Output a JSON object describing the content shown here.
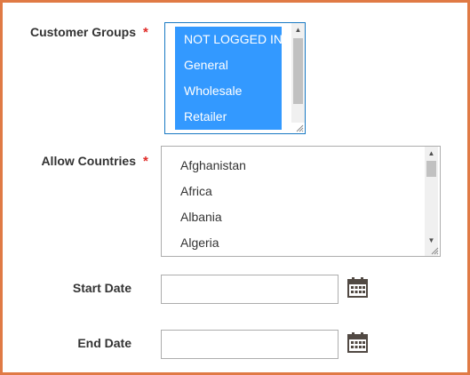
{
  "form": {
    "customer_groups": {
      "label": "Customer Groups",
      "required_mark": "*",
      "options": [
        "NOT LOGGED IN",
        "General",
        "Wholesale",
        "Retailer"
      ],
      "selected": [
        "NOT LOGGED IN",
        "General",
        "Wholesale",
        "Retailer"
      ]
    },
    "allow_countries": {
      "label": "Allow Countries",
      "required_mark": "*",
      "options": [
        "Afghanistan",
        "Africa",
        "Albania",
        "Algeria"
      ]
    },
    "start_date": {
      "label": "Start Date",
      "value": ""
    },
    "end_date": {
      "label": "End Date",
      "value": ""
    }
  },
  "colors": {
    "frame_border": "#e07a45",
    "selection": "#3399ff",
    "required": "#e02b27",
    "label_text": "#333333"
  },
  "icons": {
    "calendar": "calendar-icon",
    "scroll_up": "scroll-up-arrow-icon",
    "scroll_down": "scroll-down-arrow-icon",
    "resize": "resize-grip-icon"
  }
}
